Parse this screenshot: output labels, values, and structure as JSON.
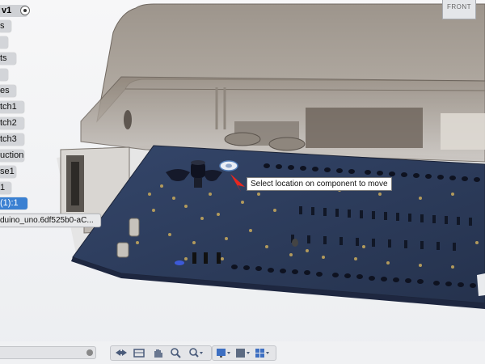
{
  "browser": {
    "top_label": "v1",
    "items": [
      {
        "label": "s"
      },
      {
        "label": ""
      },
      {
        "label": "ts"
      },
      {
        "label": ""
      },
      {
        "label": "es"
      },
      {
        "label": "tch1"
      },
      {
        "label": "tch2"
      },
      {
        "label": "tch3"
      },
      {
        "label": "uction"
      },
      {
        "label": "se1"
      },
      {
        "label": "1"
      },
      {
        "label": "(1):1"
      },
      {
        "label": "duino_uno.6df525b0-aC..."
      }
    ]
  },
  "viewcube": {
    "face_label": "FRONT"
  },
  "tooltip": {
    "text": "Select location on component to move"
  },
  "colors": {
    "selection": "#3a80d2",
    "pcb": "#2e3c58",
    "pin_marker": "#e8271f"
  },
  "toolbar_icons": [
    "orbit-icon",
    "pan-icon",
    "hand-icon",
    "zoom-icon",
    "zoom-window-icon",
    "display-settings-icon",
    "visual-style-icon",
    "grid-icon"
  ]
}
